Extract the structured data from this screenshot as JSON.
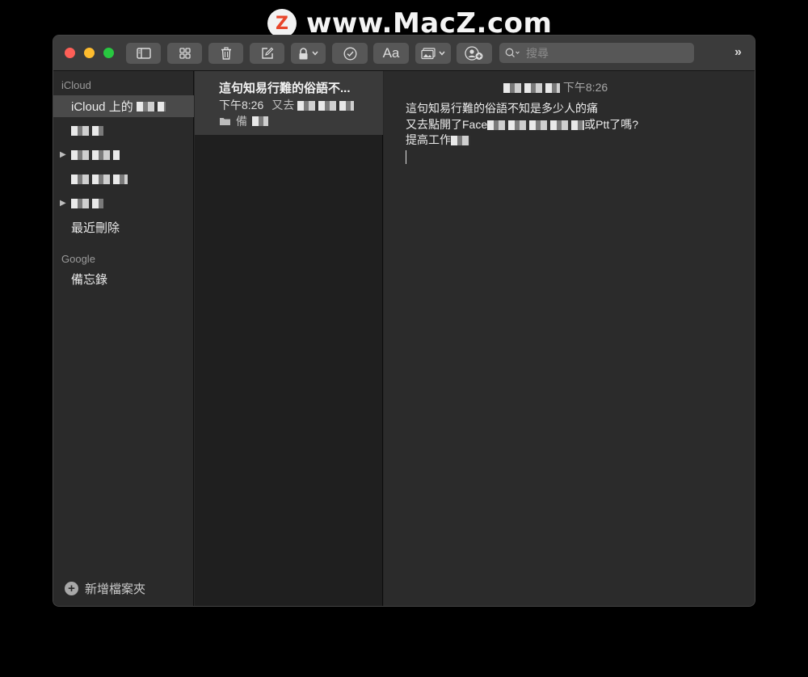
{
  "watermark": {
    "logo_letter": "Z",
    "text": "www.MacZ.com"
  },
  "toolbar": {
    "buttons": [
      {
        "name": "sidebar-toggle-button",
        "icon": "sidebar-icon"
      },
      {
        "name": "gallery-view-button",
        "icon": "grid-icon"
      },
      {
        "name": "delete-button",
        "icon": "trash-icon"
      },
      {
        "name": "compose-button",
        "icon": "compose-icon"
      },
      {
        "name": "lock-button",
        "icon": "lock-icon"
      },
      {
        "name": "checklist-button",
        "icon": "checkmark-circle-icon"
      },
      {
        "name": "format-button",
        "icon": "text-format-icon",
        "label": "Aa"
      },
      {
        "name": "media-button",
        "icon": "photo-icon"
      },
      {
        "name": "share-button",
        "icon": "add-person-icon"
      }
    ],
    "search_placeholder": "搜尋",
    "overflow_label": "»"
  },
  "sidebar": {
    "sections": [
      {
        "title": "iCloud",
        "folders": [
          {
            "label": "iCloud 上的",
            "selected": true
          },
          {
            "label": ""
          },
          {
            "label": "",
            "expandable": true
          },
          {
            "label": ""
          },
          {
            "label": "",
            "expandable": true
          },
          {
            "label": "最近刪除"
          }
        ]
      },
      {
        "title": "Google",
        "folders": [
          {
            "label": "備忘錄"
          }
        ]
      }
    ],
    "new_folder_label": "新增檔案夾"
  },
  "notes_list": {
    "items": [
      {
        "title": "這句知易行難的俗語不...",
        "time": "下午8:26",
        "preview": "又去",
        "folder": "備"
      }
    ]
  },
  "editor": {
    "date": "下午8:26",
    "lines": [
      "這句知易行難的俗語不知是多少人的痛",
      "又去點開了Face",
      "或Ptt了嗎?",
      "提高工作"
    ]
  },
  "colors": {
    "red": "#fe5f57",
    "yellow": "#febc2e",
    "green": "#28c840"
  }
}
